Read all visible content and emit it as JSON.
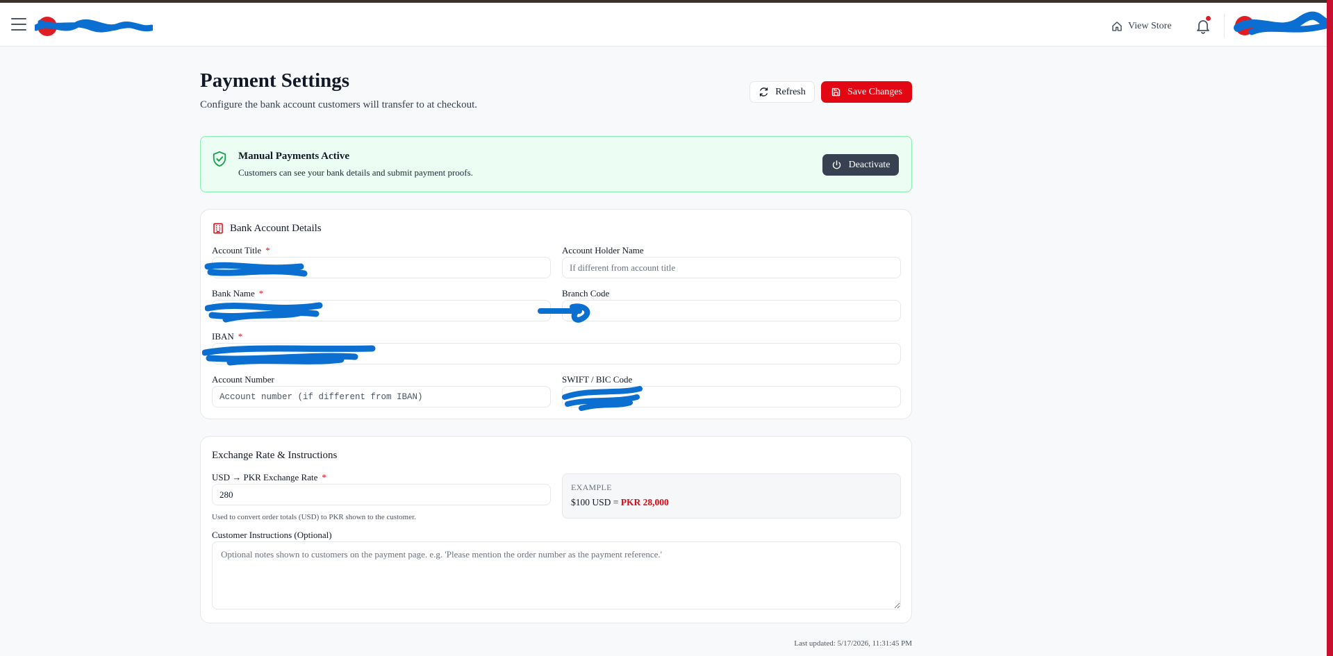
{
  "header": {
    "view_store_label": "View Store",
    "notification_dot_color": "#e11d24"
  },
  "page": {
    "title": "Payment Settings",
    "subtitle": "Configure the bank account customers will transfer to at checkout.",
    "refresh_label": "Refresh",
    "save_label": "Save Changes"
  },
  "status": {
    "title": "Manual Payments Active",
    "description": "Customers can see your bank details and submit payment proofs.",
    "deactivate_label": "Deactivate"
  },
  "bank": {
    "title": "Bank Account Details",
    "account_title": {
      "label": "Account Title",
      "required": "*",
      "value": ""
    },
    "account_holder": {
      "label": "Account Holder Name",
      "placeholder": "If different from account title",
      "value": ""
    },
    "bank_name": {
      "label": "Bank Name",
      "required": "*",
      "value": ""
    },
    "branch_code": {
      "label": "Branch Code",
      "value": ""
    },
    "iban": {
      "label": "IBAN",
      "required": "*",
      "value": ""
    },
    "account_number": {
      "label": "Account Number",
      "placeholder": "Account number (if different from IBAN)",
      "value": ""
    },
    "swift": {
      "label": "SWIFT / BIC Code",
      "value": ""
    }
  },
  "exchange": {
    "title": "Exchange Rate & Instructions",
    "rate": {
      "label": "USD → PKR Exchange Rate",
      "required": "*",
      "value": "280"
    },
    "help": "Used to convert order totals (USD) to PKR shown to the customer.",
    "example_label": "EXAMPLE",
    "example_usd": "$100 USD = ",
    "example_pkr": "PKR 28,000",
    "instructions_label": "Customer Instructions (Optional)",
    "instructions_placeholder": "Optional notes shown to customers on the payment page. e.g. 'Please mention the order number as the payment reference.'"
  },
  "footer": {
    "last_updated": "Last updated: 5/17/2026, 11:31:45 PM"
  },
  "colors": {
    "brand": "#e30613",
    "success_bg": "#ecfdf3",
    "success_border": "#86efac",
    "dark_button": "#374151",
    "redaction": "#0a6fd1"
  }
}
